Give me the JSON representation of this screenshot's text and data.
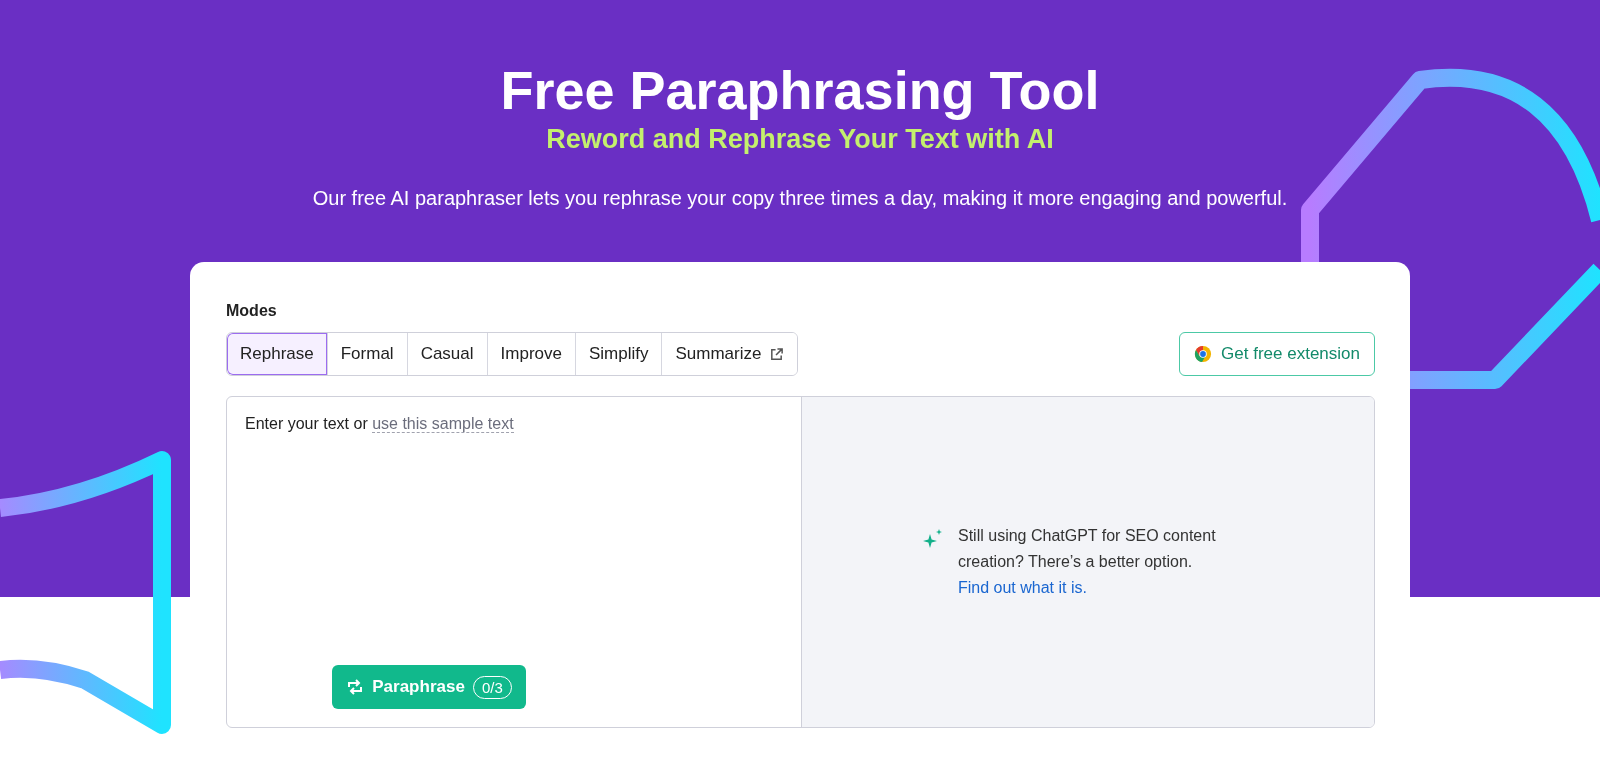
{
  "hero": {
    "title": "Free Paraphrasing Tool",
    "subtitle": "Reword and Rephrase Your Text with AI",
    "description": "Our free AI paraphraser lets you rephrase your copy three times a day, making it more engaging and powerful."
  },
  "modes": {
    "label": "Modes",
    "tabs": [
      {
        "label": "Rephrase",
        "selected": true,
        "external": false
      },
      {
        "label": "Formal",
        "selected": false,
        "external": false
      },
      {
        "label": "Casual",
        "selected": false,
        "external": false
      },
      {
        "label": "Improve",
        "selected": false,
        "external": false
      },
      {
        "label": "Simplify",
        "selected": false,
        "external": false
      },
      {
        "label": "Summarize",
        "selected": false,
        "external": true
      }
    ]
  },
  "extension_button": {
    "label": "Get free extension"
  },
  "editor": {
    "prompt": "Enter your text or",
    "sample_link": "use this sample text",
    "button": {
      "label": "Paraphrase",
      "count": "0/3"
    }
  },
  "output_panel": {
    "message": "Still using ChatGPT for SEO content creation? There’s a better option.",
    "link": "Find out what it is."
  }
}
